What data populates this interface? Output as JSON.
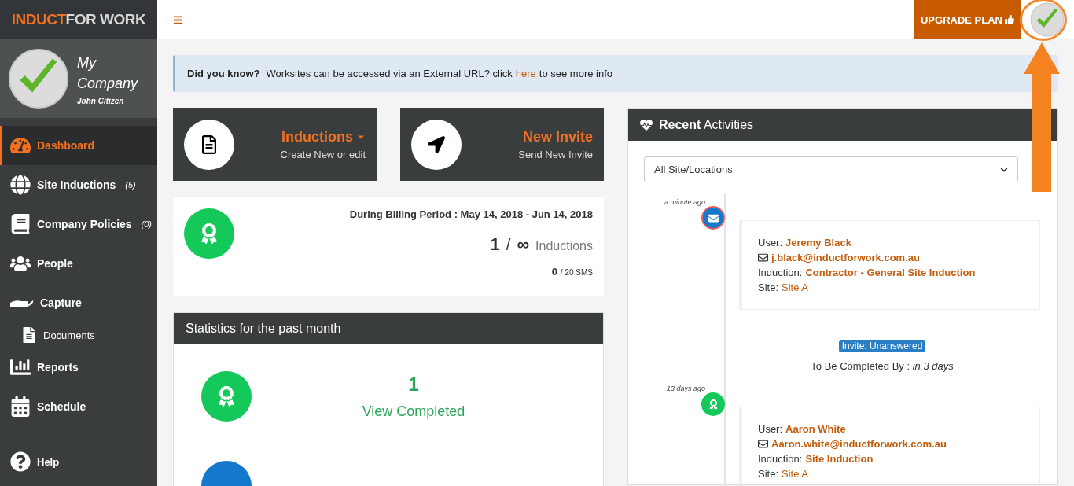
{
  "brand": {
    "logo_accent": "INDUCT",
    "logo_rest": "FOR WORK"
  },
  "profile": {
    "company": "My Company",
    "user": "John Citizen"
  },
  "sidebar": {
    "items": [
      {
        "kind": "main",
        "label": "Dashboard",
        "selected": true
      },
      {
        "kind": "main",
        "label": "Site Inductions",
        "count": "(5)",
        "selected": false
      },
      {
        "kind": "main",
        "label": "Company Policies",
        "count": "(0)",
        "selected": false
      },
      {
        "kind": "main",
        "label": "People",
        "selected": false
      },
      {
        "kind": "main",
        "label": "Capture",
        "selected": false
      },
      {
        "kind": "sub",
        "label": "Documents",
        "selected": false
      },
      {
        "kind": "main",
        "label": "Reports",
        "selected": false
      },
      {
        "kind": "main",
        "label": "Schedule",
        "selected": false
      },
      {
        "kind": "footer",
        "label": "Help",
        "selected": false
      }
    ]
  },
  "topbar": {
    "upgrade_button": "UPGRADE PLAN"
  },
  "alert": {
    "lead": "Did you know?",
    "text": "Worksites can be accessed via an External URL? click",
    "link": "here",
    "tail": "to see more info"
  },
  "tiles": [
    {
      "title": "Inductions",
      "subtitle": "Create New or edit",
      "dropdown": true
    },
    {
      "title": "New Invite",
      "subtitle": "Send New Invite",
      "dropdown": false
    }
  ],
  "billing": {
    "period_label": "During Billing Period :",
    "period": "May 14, 2018 - Jun 14, 2018",
    "used": "1",
    "separator": "/",
    "limit": "∞",
    "unit": "Inductions",
    "sms_used": "0",
    "sms_limit": "/ 20 SMS"
  },
  "stats": {
    "title": "Statistics for the past month",
    "value": "1",
    "label": "View Completed"
  },
  "activities": {
    "title_bold": "Recent",
    "title_rest": "Activities",
    "filter": "All Site/Locations",
    "entries": [
      {
        "time": "a minute ago",
        "kind": "invite",
        "fields": [
          {
            "kind": "text",
            "label": "User:",
            "value": "Jeremy Black"
          },
          {
            "kind": "email",
            "value": "j.black@inductforwork.com.au"
          },
          {
            "kind": "text",
            "label": "Induction:",
            "value": "Contractor - General Site Induction"
          },
          {
            "kind": "plain",
            "label": "Site:",
            "value": "Site A"
          }
        ],
        "status": "Invite: Unanswered",
        "due_label": "To Be Completed By :",
        "due": "in 3 days"
      },
      {
        "time": "13 days ago",
        "kind": "completed",
        "fields": [
          {
            "kind": "text",
            "label": "User:",
            "value": "Aaron White"
          },
          {
            "kind": "email",
            "value": "Aaron.white@inductforwork.com.au"
          },
          {
            "kind": "text",
            "label": "Induction:",
            "value": "Site Induction"
          },
          {
            "kind": "plain",
            "label": "Site:",
            "value": "Site A"
          }
        ]
      }
    ]
  }
}
